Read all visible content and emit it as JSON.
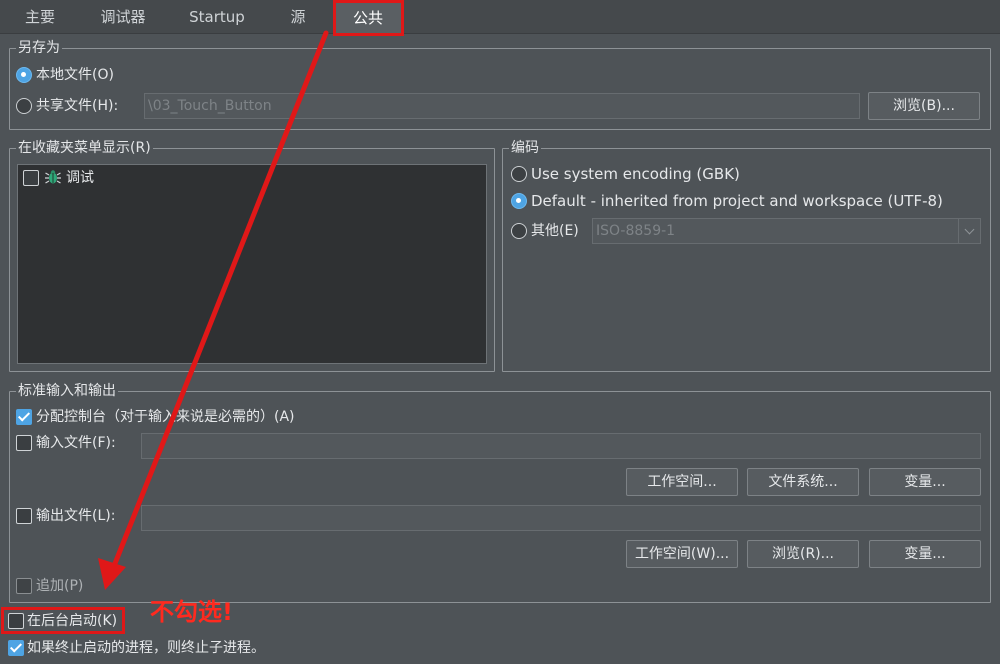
{
  "tabs": [
    "主要",
    "调试器",
    "Startup",
    "源",
    "公共"
  ],
  "save_as": {
    "title": "另存为",
    "local_file": "本地文件(O)",
    "shared_file": "共享文件(H):",
    "shared_path": "\\03_Touch_Button",
    "browse": "浏览(B)..."
  },
  "favorites": {
    "title": "在收藏夹菜单显示(R)",
    "items": [
      {
        "label": "调试",
        "checked": false,
        "icon": "bug-icon"
      }
    ]
  },
  "encoding": {
    "title": "编码",
    "system": "Use system encoding (GBK)",
    "default": "Default - inherited from project and workspace (UTF-8)",
    "other": "其他(E)",
    "other_value": "ISO-8859-1",
    "selected": "default"
  },
  "std_io": {
    "title": "标准输入和输出",
    "allocate_console": "分配控制台（对于输入来说是必需的）(A)",
    "input_file": "输入文件(F):",
    "output_file": "输出文件(L):",
    "workspace_btn": "工作空间...",
    "filesystem_btn": "文件系统...",
    "variables_btn": "变量...",
    "workspace_btn2": "工作空间(W)...",
    "browse_btn2": "浏览(R)...",
    "variables_btn2": "变量...",
    "append": "追加(P)"
  },
  "launch_background": "在后台启动(K)",
  "terminate_children": "如果终止启动的进程，则终止子进程。",
  "annotation": {
    "text": "不勾选!",
    "color": "#ff2a1f"
  },
  "colors": {
    "background": "#4e5357",
    "accent": "#4ea4e4",
    "annotation_red": "#e01818"
  }
}
